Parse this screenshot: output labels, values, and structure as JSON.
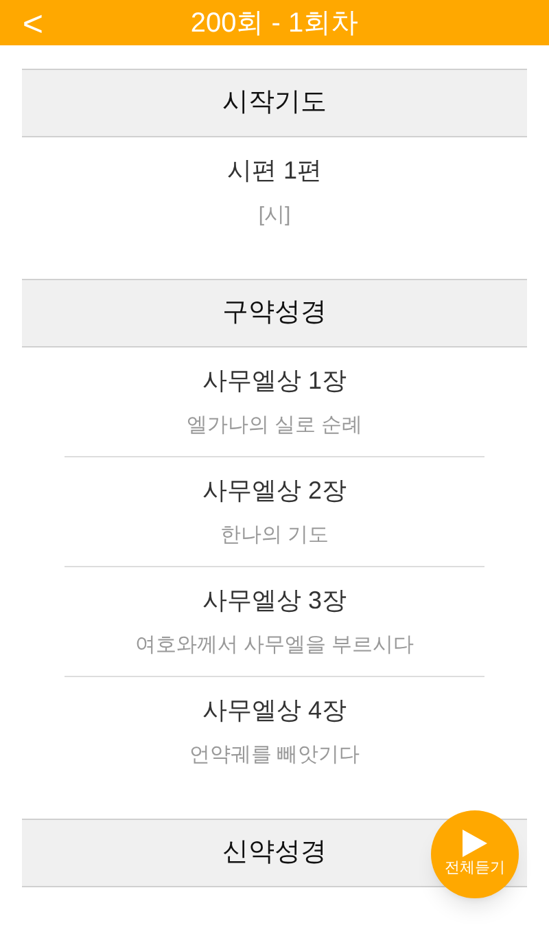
{
  "header": {
    "back": "<",
    "title": "200회 - 1회차"
  },
  "sections": [
    {
      "title": "시작기도",
      "items": [
        {
          "title": "시편 1편",
          "subtitle": "[시]"
        }
      ]
    },
    {
      "title": "구약성경",
      "items": [
        {
          "title": "사무엘상 1장",
          "subtitle": "엘가나의 실로 순례"
        },
        {
          "title": "사무엘상 2장",
          "subtitle": "한나의 기도"
        },
        {
          "title": "사무엘상 3장",
          "subtitle": "여호와께서 사무엘을 부르시다"
        },
        {
          "title": "사무엘상 4장",
          "subtitle": "언약궤를 빼앗기다"
        }
      ]
    },
    {
      "title": "신약성경"
    }
  ],
  "fab": {
    "label": "전체듣기"
  }
}
